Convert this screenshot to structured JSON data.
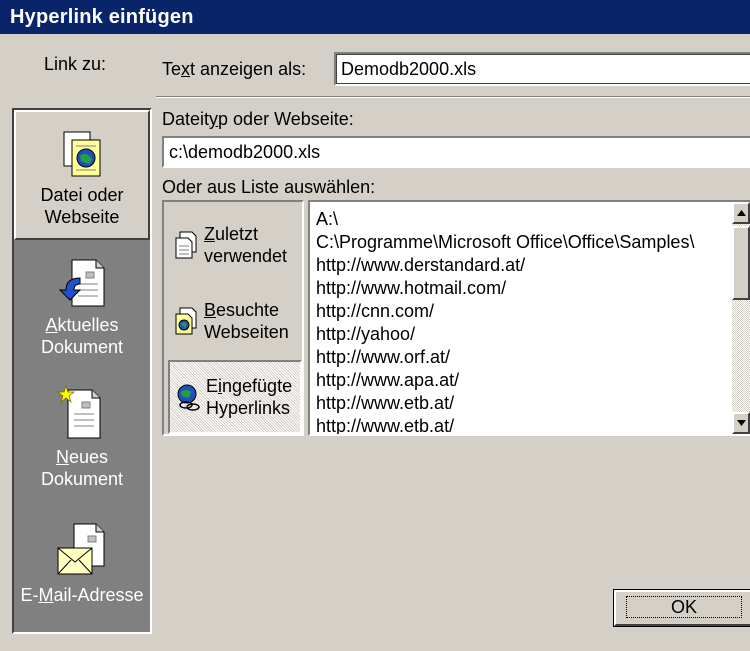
{
  "window": {
    "title": "Hyperlink einfügen"
  },
  "link_to": {
    "label": "Link zu:",
    "items": [
      {
        "icon": "file-web-icon",
        "line1": "Datei oder",
        "line2": "Webseite",
        "selected": true
      },
      {
        "icon": "current-document-icon",
        "line1_u": "A",
        "line1_rest": "ktuelles",
        "line2": "Dokument",
        "selected": false
      },
      {
        "icon": "new-document-icon",
        "line1_u": "N",
        "line1_rest": "eues",
        "line2": "Dokument",
        "selected": false
      },
      {
        "icon": "email-icon",
        "pre": "E-",
        "u": "M",
        "post": "ail-Adresse",
        "selected": false
      }
    ]
  },
  "display_text": {
    "label_pre": "Te",
    "label_u": "x",
    "label_post": "t anzeigen als:",
    "value": "Demodb2000.xls"
  },
  "file_or_web": {
    "label_pre": "Dateit",
    "label_u": "y",
    "label_post": "p oder Webseite:",
    "value": "c:\\demodb2000.xls"
  },
  "list": {
    "label": "Oder aus Liste auswählen:",
    "categories": [
      {
        "icon": "recent-files-icon",
        "u": "Z",
        "line1_rest": "uletzt",
        "line2": "verwendet",
        "selected": false
      },
      {
        "icon": "visited-pages-icon",
        "u": "B",
        "line1_rest": "esuchte",
        "line2": "Webseiten",
        "selected": false
      },
      {
        "icon": "inserted-links-icon",
        "line1_pre": "E",
        "u": "i",
        "line1_rest": "ngefügte",
        "line2": "Hyperlinks",
        "selected": true
      }
    ],
    "items": [
      "A:\\",
      "C:\\Programme\\Microsoft Office\\Office\\Samples\\",
      "http://www.derstandard.at/",
      "http://www.hotmail.com/",
      "http://cnn.com/",
      "http://yahoo/",
      "http://www.orf.at/",
      "http://www.apa.at/",
      "http://www.etb.at/",
      "http://www.etb.at/"
    ]
  },
  "buttons": {
    "ok": "OK"
  },
  "colors": {
    "titlebar": "#0a246a",
    "dialog": "#d4d0c8",
    "sidebar": "#808080"
  }
}
